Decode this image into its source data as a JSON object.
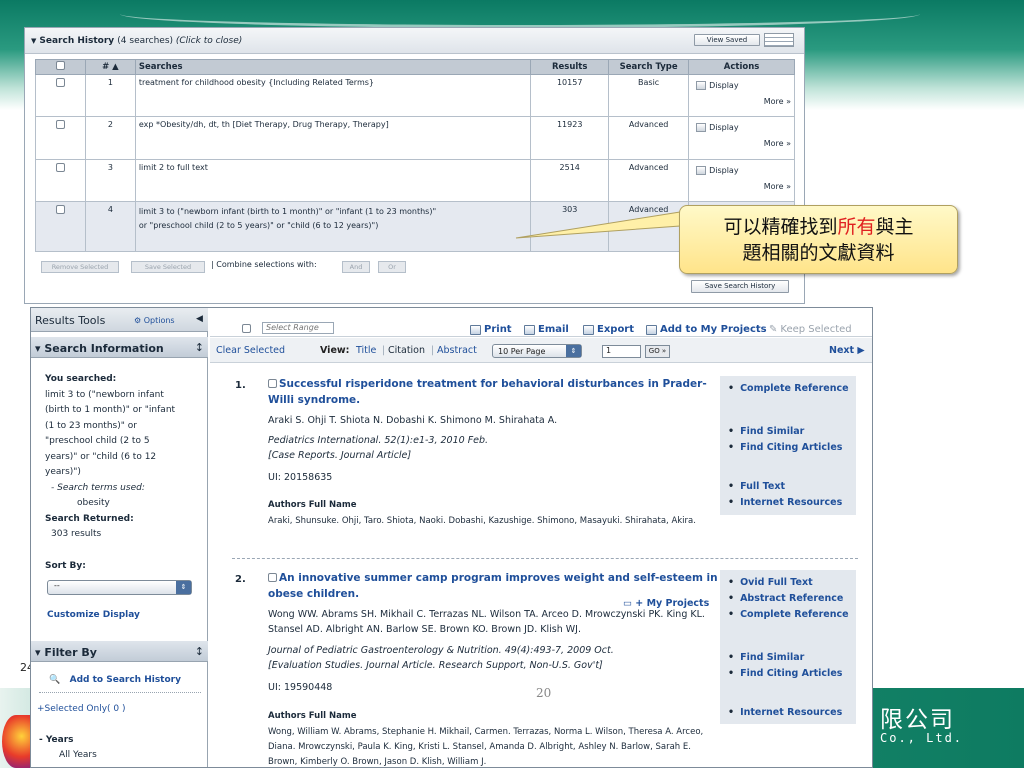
{
  "slide": {
    "number": "24",
    "page_number": "20",
    "company_cn": "限公司",
    "company_en": "Co., Ltd."
  },
  "search_history": {
    "title": "Search History",
    "count_text": "(4 searches)",
    "close_text": "(Click to close)",
    "view_saved_label": "View Saved",
    "columns": [
      "# ▲",
      "Searches",
      "Results",
      "Search Type",
      "Actions"
    ],
    "rows": [
      {
        "num": "1",
        "query": "treatment for childhood obesity {Including Related Terms}",
        "results": "10157",
        "type": "Basic",
        "action": "Display",
        "more": "More »"
      },
      {
        "num": "2",
        "query": "exp *Obesity/dh, dt, th [Diet Therapy, Drug Therapy, Therapy]",
        "results": "11923",
        "type": "Advanced",
        "action": "Display",
        "more": "More »"
      },
      {
        "num": "3",
        "query": "limit 2 to full text",
        "results": "2514",
        "type": "Advanced",
        "action": "Display",
        "more": "More »"
      },
      {
        "num": "4",
        "query": "limit 3 to (\"newborn infant (birth to 1 month)\" or \"infant (1 to 23 months)\" or \"preschool child (2 to 5 years)\" or \"child (6 to 12 years)\")",
        "results": "303",
        "type": "Advanced"
      }
    ],
    "remove_selected": "Remove Selected",
    "save_selected": "Save Selected",
    "combine_label": "| Combine selections with:",
    "and_label": "And",
    "or_label": "Or",
    "save_history_label": "Save Search History"
  },
  "callout": {
    "line1_pre": "可以精確找到",
    "line1_hl": "所有",
    "line1_post": "與主",
    "line2": "題相關的文獻資料"
  },
  "left_panel": {
    "results_tools": "Results Tools",
    "options": "Options",
    "search_information": "Search Information",
    "you_searched": "You searched:",
    "searched_lines": [
      "limit 3 to (\"newborn infant",
      "(birth to 1 month)\" or \"infant",
      "(1 to 23 months)\" or",
      "\"preschool child (2 to 5",
      "years)\" or \"child (6 to 12",
      "years)\")"
    ],
    "terms_used_label": "- Search terms used:",
    "term": "obesity",
    "search_returned": "Search Returned:",
    "returned_count": "303 results",
    "sort_by": "Sort By:",
    "sort_value": "--",
    "customize_display": "Customize Display",
    "filter_by": "Filter By",
    "add_to_history": "Add to Search History",
    "selected_only": "+Selected Only( 0 )",
    "years": "- Years",
    "all_years": "All Years"
  },
  "toolbar": {
    "select_range_placeholder": "Select Range",
    "print": "Print",
    "email": "Email",
    "export": "Export",
    "add_to_projects": "Add to My Projects",
    "keep_selected": "Keep Selected",
    "clear_selected": "Clear Selected",
    "view_label": "View:",
    "view_title": "Title",
    "view_citation": "Citation",
    "view_abstract": "Abstract",
    "per_page": "10 Per Page",
    "page": "1",
    "go": "GO »",
    "next": "Next ▶"
  },
  "results": [
    {
      "num": "1.",
      "title": "Successful risperidone treatment for behavioral disturbances in Prader-Willi syndrome.",
      "authors": "Araki S. Ohji T. Shiota N. Dobashi K. Shimono M. Shirahata A.",
      "journal": "Pediatrics International. 52(1):e1-3, 2010 Feb.",
      "pubtype": "[Case Reports. Journal Article]",
      "ui": "UI: 20158635",
      "afn_label": "Authors Full Name",
      "afn": "Araki, Shunsuke. Ohji, Taro. Shiota, Naoki. Dobashi, Kazushige. Shimono, Masayuki. Shirahata, Akira.",
      "my_projects": "+ My Projects",
      "links": [
        "Complete Reference",
        "Find Similar",
        "Find Citing Articles",
        "Full Text",
        "Internet Resources"
      ]
    },
    {
      "num": "2.",
      "title": "An innovative summer camp program improves weight and self-esteem in obese children.",
      "authors": "Wong WW. Abrams SH. Mikhail C. Terrazas NL. Wilson TA. Arceo D. Mrowczynski PK. King KL. Stansel AD. Albright AN. Barlow SE. Brown KO. Brown JD. Klish WJ.",
      "journal": "Journal of Pediatric Gastroenterology & Nutrition. 49(4):493-7, 2009 Oct.",
      "pubtype": "[Evaluation Studies. Journal Article. Research Support, Non-U.S. Gov't]",
      "ui": "UI: 19590448",
      "afn_label": "Authors Full Name",
      "afn": "Wong, William W. Abrams, Stephanie H. Mikhail, Carmen. Terrazas, Norma L. Wilson, Theresa A. Arceo, Diana. Mrowczynski, Paula K. King, Kristi L. Stansel, Amanda D. Albright, Ashley N. Barlow, Sarah E. Brown, Kimberly O. Brown, Jason D. Klish, William J.",
      "links": [
        "Ovid Full Text",
        "Abstract Reference",
        "Complete Reference",
        "Find Similar",
        "Find Citing Articles",
        "Internet Resources"
      ]
    }
  ]
}
